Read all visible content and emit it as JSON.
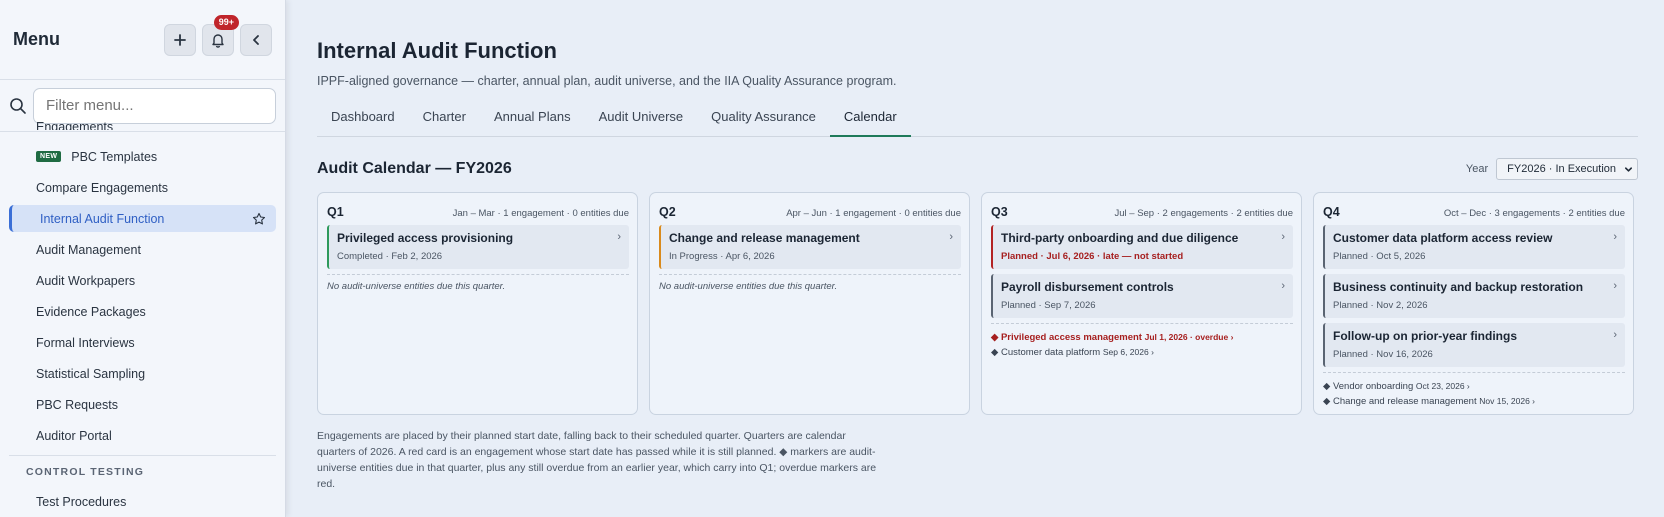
{
  "sidebar": {
    "title": "Menu",
    "notif_badge": "99+",
    "search_placeholder": "Filter menu...",
    "cut_item": "Engagements",
    "items": [
      {
        "label": "PBC Templates",
        "tag": "NEW"
      },
      {
        "label": "Compare Engagements"
      },
      {
        "label": "Internal Audit Function",
        "active": true
      },
      {
        "label": "Audit Management"
      },
      {
        "label": "Audit Workpapers"
      },
      {
        "label": "Evidence Packages"
      },
      {
        "label": "Formal Interviews"
      },
      {
        "label": "Statistical Sampling"
      },
      {
        "label": "PBC Requests"
      },
      {
        "label": "Auditor Portal"
      }
    ],
    "section": "CONTROL TESTING",
    "section_items": [
      {
        "label": "Test Procedures"
      }
    ]
  },
  "page": {
    "title": "Internal Audit Function",
    "subtitle": "IPPF-aligned governance — charter, annual plan, audit universe, and the IIA Quality Assurance program.",
    "tabs": [
      "Dashboard",
      "Charter",
      "Annual Plans",
      "Audit Universe",
      "Quality Assurance",
      "Calendar"
    ],
    "active_tab": "Calendar"
  },
  "calendar": {
    "title": "Audit Calendar — FY2026",
    "year_label": "Year",
    "year_value": "FY2026 · In Execution",
    "quarters": [
      {
        "name": "Q1",
        "meta": "Jan – Mar · 1 engagement · 0 entities due",
        "cards": [
          {
            "title": "Privileged access provisioning",
            "sub": "Completed · Feb 2, 2026",
            "color": "green"
          }
        ],
        "empty": "No audit-universe entities due this quarter.",
        "due": []
      },
      {
        "name": "Q2",
        "meta": "Apr – Jun · 1 engagement · 0 entities due",
        "cards": [
          {
            "title": "Change and release management",
            "sub": "In Progress · Apr 6, 2026",
            "color": "orange"
          }
        ],
        "empty": "No audit-universe entities due this quarter.",
        "due": []
      },
      {
        "name": "Q3",
        "meta": "Jul – Sep · 2 engagements · 2 entities due",
        "cards": [
          {
            "title": "Third-party onboarding and due diligence",
            "sub": "Planned · Jul 6, 2026 · late — not started",
            "color": "red",
            "late": true
          },
          {
            "title": "Payroll disbursement controls",
            "sub": "Planned · Sep 7, 2026",
            "color": "slate"
          }
        ],
        "empty": "",
        "due": [
          {
            "name": "Privileged access management",
            "date": "Jul 1, 2026 · overdue ›",
            "overdue": true
          },
          {
            "name": "Customer data platform",
            "date": "Sep 6, 2026 ›",
            "overdue": false
          }
        ]
      },
      {
        "name": "Q4",
        "meta": "Oct – Dec · 3 engagements · 2 entities due",
        "cards": [
          {
            "title": "Customer data platform access review",
            "sub": "Planned · Oct 5, 2026",
            "color": "slate"
          },
          {
            "title": "Business continuity and backup restoration",
            "sub": "Planned · Nov 2, 2026",
            "color": "slate"
          },
          {
            "title": "Follow-up on prior-year findings",
            "sub": "Planned · Nov 16, 2026",
            "color": "slate"
          }
        ],
        "empty": "",
        "due": [
          {
            "name": "Vendor onboarding",
            "date": "Oct 23, 2026 ›",
            "overdue": false
          },
          {
            "name": "Change and release management",
            "date": "Nov 15, 2026 ›",
            "overdue": false
          }
        ]
      }
    ],
    "footnote": "Engagements are placed by their planned start date, falling back to their scheduled quarter. Quarters are calendar quarters of 2026. A red card is an engagement whose start date has passed while it is still planned. ◆ markers are audit-universe entities due in that quarter, plus any still overdue from an earlier year, which carry into Q1; overdue markers are red."
  }
}
